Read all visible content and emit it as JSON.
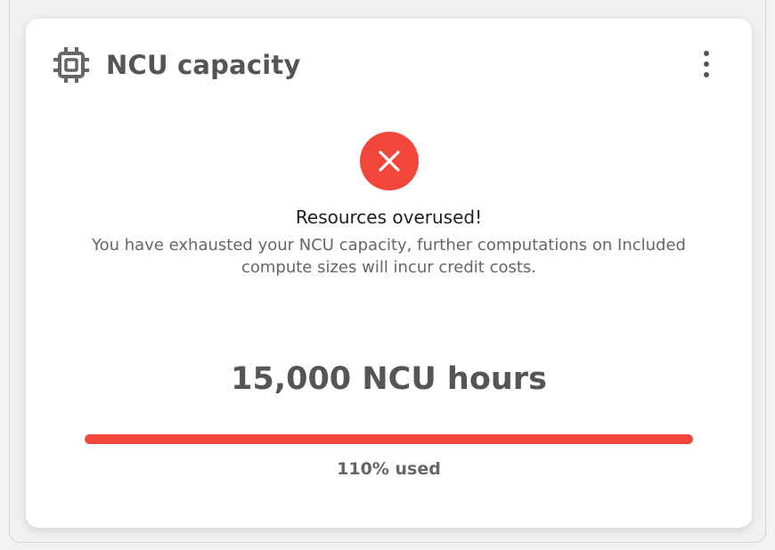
{
  "card": {
    "title": "NCU capacity",
    "title_icon": "cpu-chip-icon",
    "menu_icon": "more-vertical-icon"
  },
  "status": {
    "icon": "close-icon",
    "icon_color": "#f3463a",
    "title": "Resources overused!",
    "description": "You have exhausted your NCU capacity, further computations on Included compute sizes will incur credit costs."
  },
  "capacity": {
    "value_label": "15,000 NCU hours",
    "usage_percent": 110,
    "usage_label": "110% used",
    "bar_color": "#f3463a"
  }
}
